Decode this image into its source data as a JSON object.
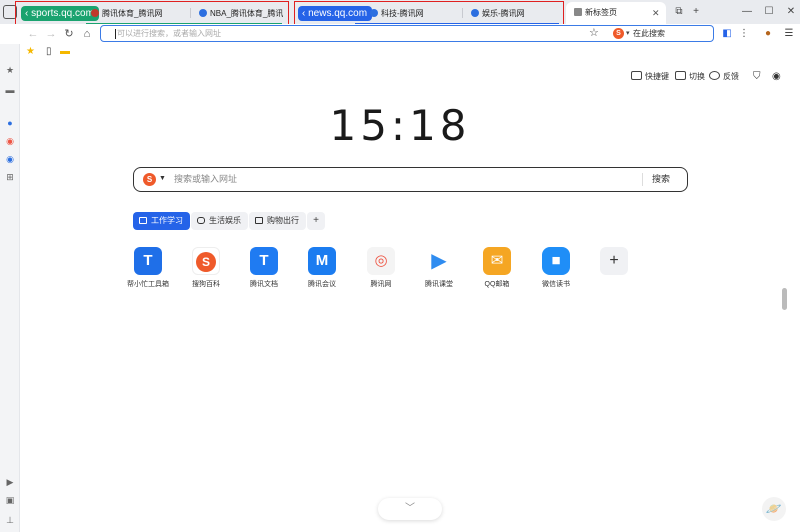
{
  "tabs": {
    "group1": {
      "label": "sports.qq.com",
      "color": "#1aa36f"
    },
    "group2": {
      "label": "news.qq.com",
      "color": "#2563e8"
    },
    "items": [
      {
        "label": "腾讯体育_腾讯网"
      },
      {
        "label": "NBA_腾讯体育_腾讯网_NB"
      },
      {
        "label": "科技-腾讯网"
      },
      {
        "label": "娱乐-腾讯网"
      },
      {
        "label": "新标签页"
      }
    ],
    "new_tab": "+"
  },
  "window": {
    "minimize": "—",
    "maximize": "☐",
    "close": "✕"
  },
  "toolbar": {
    "address_placeholder": "可以进行搜索，或者输入网址",
    "search_engine_label": "在此搜索",
    "search_engine_icon": "sogou-icon"
  },
  "main": {
    "actions": {
      "shortcut": "快捷键",
      "switch": "切换",
      "feedback": "反馈"
    },
    "clock": "15:18",
    "search": {
      "placeholder": "搜索或输入网址",
      "button": "搜索"
    },
    "categories": [
      {
        "label": "工作学习"
      },
      {
        "label": "生活娱乐"
      },
      {
        "label": "购物出行"
      }
    ],
    "apps": [
      {
        "label": "帮小忙工具箱",
        "icon": "T",
        "color": "#1f6fe8"
      },
      {
        "label": "搜狗百科",
        "icon": "S",
        "color": "#ef5a2a"
      },
      {
        "label": "腾讯文档",
        "icon": "T",
        "color": "#1f7bf2"
      },
      {
        "label": "腾讯会议",
        "icon": "M",
        "color": "#1b7cf0"
      },
      {
        "label": "腾讯网",
        "icon": "◎",
        "color": "#f4f4f4"
      },
      {
        "label": "腾讯课堂",
        "icon": "▶",
        "color": "#2f8cf0"
      },
      {
        "label": "QQ邮箱",
        "icon": "✉",
        "color": "#f5a623"
      },
      {
        "label": "微信读书",
        "icon": "■",
        "color": "#1f8ef7"
      }
    ],
    "add_app": "+"
  }
}
